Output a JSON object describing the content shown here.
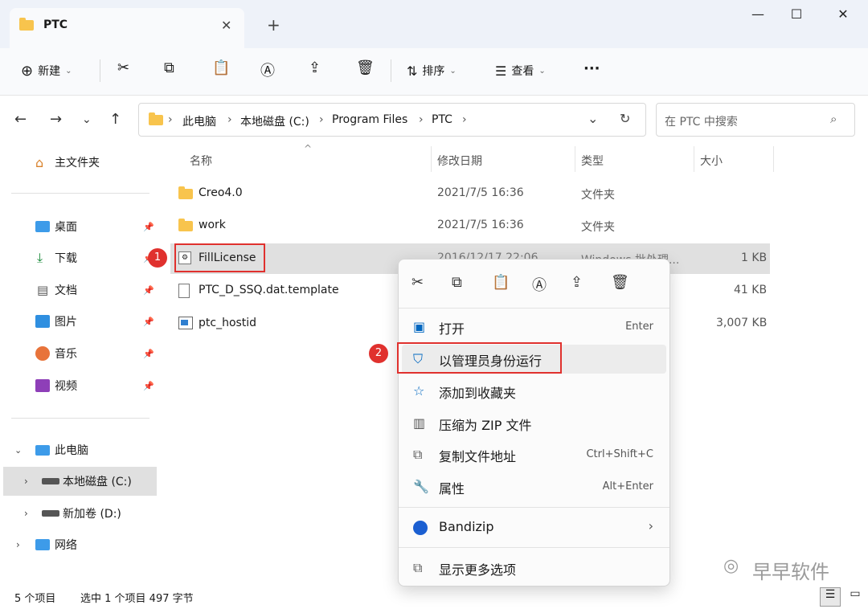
{
  "window": {
    "tab_title": "PTC",
    "tab_close": "✕",
    "new_tab": "+",
    "minimize": "—",
    "maximize": "☐",
    "close": "✕"
  },
  "toolbar": {
    "new_label": "新建",
    "sort_label": "排序",
    "view_label": "查看",
    "more_label": "···"
  },
  "address": {
    "crumbs": [
      "此电脑",
      "本地磁盘 (C:)",
      "Program Files",
      "PTC"
    ],
    "search_placeholder": "在 PTC 中搜索"
  },
  "sidebar": {
    "home": "主文件夹",
    "quick": [
      "桌面",
      "下载",
      "文档",
      "图片",
      "音乐",
      "视频"
    ],
    "this_pc": "此电脑",
    "drives": [
      "本地磁盘 (C:)",
      "新加卷 (D:)"
    ],
    "network": "网络"
  },
  "columns": {
    "name": "名称",
    "modified": "修改日期",
    "type": "类型",
    "size": "大小"
  },
  "files": [
    {
      "name": "Creo4.0",
      "modified": "2021/7/5 16:36",
      "type": "文件夹",
      "size": ""
    },
    {
      "name": "work",
      "modified": "2021/7/5 16:36",
      "type": "文件夹",
      "size": ""
    },
    {
      "name": "FillLicense",
      "modified": "2016/12/17 22:06",
      "type": "Windows 批处理...",
      "size": "1 KB"
    },
    {
      "name": "PTC_D_SSQ.dat.template",
      "modified": "",
      "type": "",
      "size": "41 KB"
    },
    {
      "name": "ptc_hostid",
      "modified": "",
      "type": "",
      "size": "3,007 KB"
    }
  ],
  "context_menu": {
    "items": [
      {
        "label": "打开",
        "shortcut": "Enter"
      },
      {
        "label": "以管理员身份运行",
        "shortcut": ""
      },
      {
        "label": "添加到收藏夹",
        "shortcut": ""
      },
      {
        "label": "压缩为 ZIP 文件",
        "shortcut": ""
      },
      {
        "label": "复制文件地址",
        "shortcut": "Ctrl+Shift+C"
      },
      {
        "label": "属性",
        "shortcut": "Alt+Enter"
      }
    ],
    "bandizip": "Bandizip",
    "more_options": "显示更多选项"
  },
  "annotations": {
    "badge1": "1",
    "badge2": "2"
  },
  "status": {
    "count": "5 个项目",
    "selection": "选中 1 个项目  497 字节"
  },
  "watermark": "早早软件",
  "colors": {
    "accent": "#0067c0",
    "highlight": "#e0312e",
    "folder": "#f8c44d"
  }
}
